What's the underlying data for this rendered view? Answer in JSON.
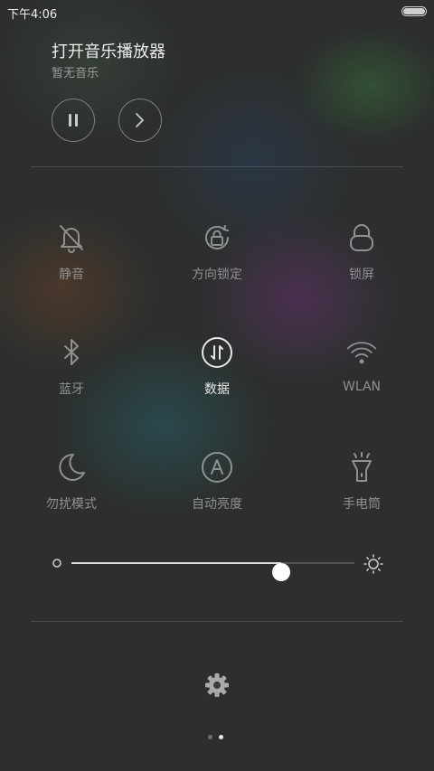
{
  "status_bar": {
    "time": "下午4:06",
    "battery_level": 1.0
  },
  "music": {
    "title": "打开音乐播放器",
    "subtitle": "暂无音乐",
    "pause_icon": "pause-icon",
    "next_icon": "chevron-right-icon"
  },
  "tiles": [
    {
      "label": "静音",
      "icon": "bell-off-icon",
      "active": false
    },
    {
      "label": "方向锁定",
      "icon": "rotation-lock-icon",
      "active": false
    },
    {
      "label": "锁屏",
      "icon": "lock-icon",
      "active": false
    },
    {
      "label": "蓝牙",
      "icon": "bluetooth-icon",
      "active": false
    },
    {
      "label": "数据",
      "icon": "mobile-data-icon",
      "active": true
    },
    {
      "label": "WLAN",
      "icon": "wifi-icon",
      "active": false
    },
    {
      "label": "勿扰模式",
      "icon": "moon-icon",
      "active": false
    },
    {
      "label": "自动亮度",
      "icon": "auto-brightness-icon",
      "active": false
    },
    {
      "label": "手电筒",
      "icon": "flashlight-icon",
      "active": false
    }
  ],
  "brightness": {
    "level": 0.74
  },
  "pager": {
    "pages": 2,
    "current": 2
  },
  "colors": {
    "active_text": "#e6e6e6",
    "inactive_text": "#8e918f"
  }
}
